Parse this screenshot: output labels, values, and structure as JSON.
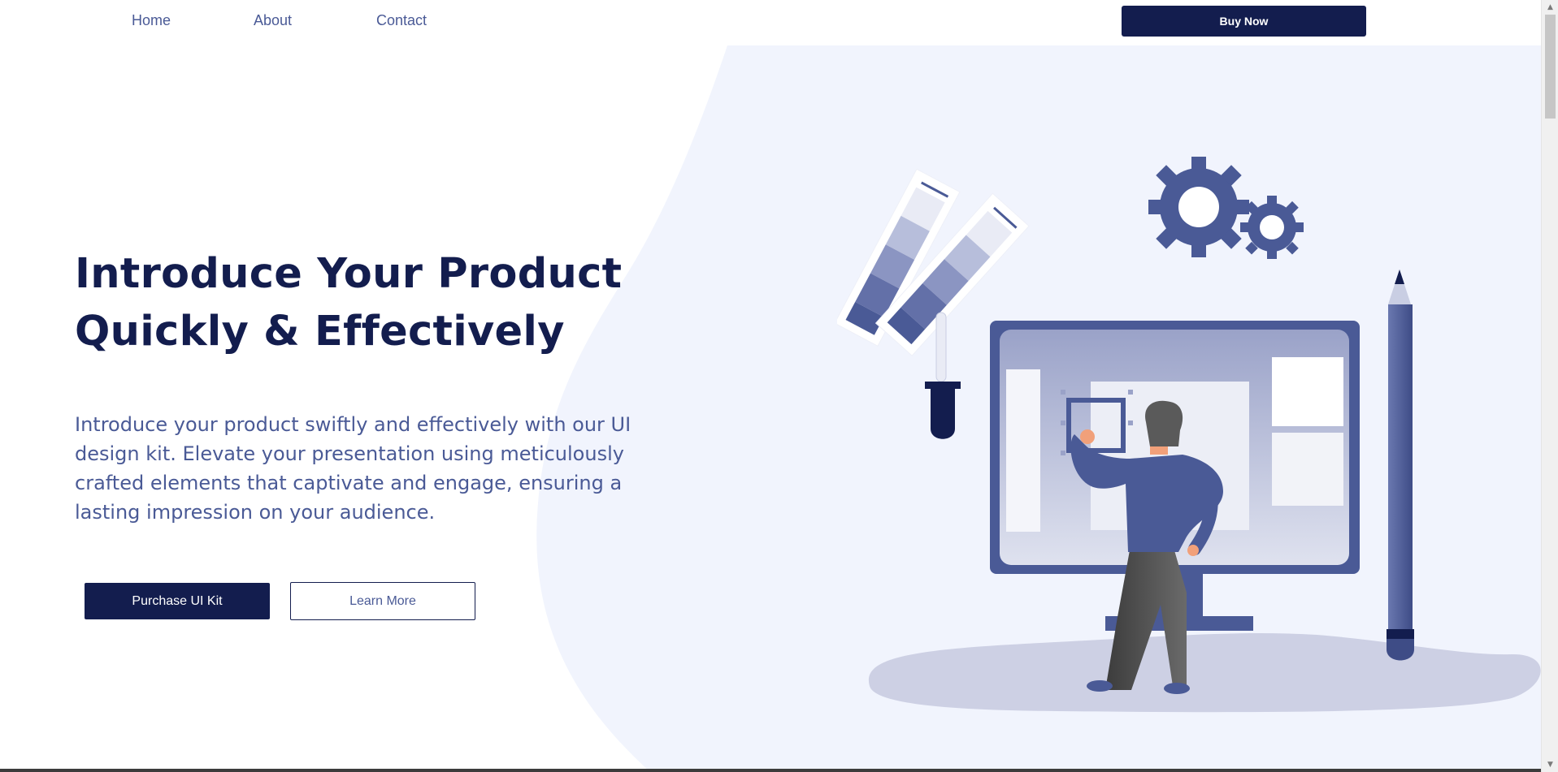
{
  "nav": {
    "links": [
      "Home",
      "About",
      "Contact"
    ],
    "cta_label": "Buy Now"
  },
  "hero": {
    "title_line1": "Introduce Your Product",
    "title_line2": "Quickly & Effectively",
    "description": "Introduce your product swiftly and effectively with our UI design kit. Elevate your presentation using meticulously crafted elements that captivate and engage, ensuring a lasting impression on your audience.",
    "primary_button": "Purchase UI Kit",
    "secondary_button": "Learn More"
  },
  "colors": {
    "brand_dark": "#131d4e",
    "accent": "#4a5a96",
    "background_blob": "#f1f4fd",
    "ground": "#cdd0e4"
  },
  "icons": [
    "gear-icon",
    "color-swatch-icon",
    "pipette-icon",
    "pencil-icon",
    "monitor-icon"
  ]
}
